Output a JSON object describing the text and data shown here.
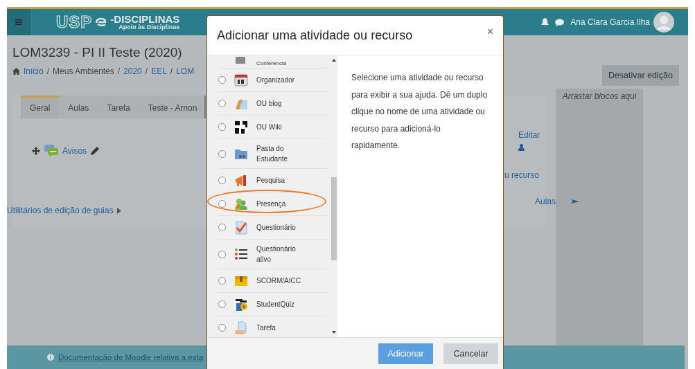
{
  "navbar": {
    "logo": "USP",
    "brand": "-DISCIPLINAS",
    "brand_sub": "Apoio às Disciplinas",
    "user": "Ana Clara Garcia Ilha"
  },
  "page": {
    "title": "LOM3239 - PI II Teste (2020)",
    "breadcrumb_separator": "/",
    "breadcrumb": [
      {
        "label": "Início",
        "link": true
      },
      {
        "label": "Meus Ambientes",
        "link": false
      },
      {
        "label": "2020",
        "link": true
      },
      {
        "label": "EEL",
        "link": true
      },
      {
        "label": "LOM",
        "link": true
      }
    ],
    "edit_button": "Desativar edição",
    "tabs": [
      {
        "label": "Geral",
        "selected": true
      },
      {
        "label": "Aulas",
        "selected": false
      },
      {
        "label": "Tarefa",
        "selected": false
      },
      {
        "label": "Teste - Arnon",
        "selected": false
      }
    ],
    "activity": "Avisos",
    "tab_utilities": "Utilitários de edição de guias",
    "right_links": [
      "Editar",
      "u recurso",
      "Aulas"
    ],
    "blocks_hint": "Arrastar blocos aqui",
    "footer": "Documentação de Moodle relativa a esta"
  },
  "dialog": {
    "title": "Adicionar uma atividade ou recurso",
    "close": "×",
    "items": [
      {
        "label": "Conferência",
        "highlighted": false
      },
      {
        "label": "Organizador",
        "selected": false,
        "highlighted": false
      },
      {
        "label": "OU blog",
        "selected": false,
        "highlighted": false
      },
      {
        "label": "OU Wiki",
        "selected": false,
        "highlighted": false
      },
      {
        "label": "Pasta do Estudante",
        "selected": false,
        "highlighted": false
      },
      {
        "label": "Pesquisa",
        "selected": false,
        "highlighted": false
      },
      {
        "label": "Presença",
        "selected": false,
        "highlighted": true
      },
      {
        "label": "Questionário",
        "selected": false,
        "highlighted": false
      },
      {
        "label": "Questionário ativo",
        "selected": false,
        "highlighted": false
      },
      {
        "label": "SCORM/AICC",
        "selected": false,
        "highlighted": false
      },
      {
        "label": "StudentQuiz",
        "selected": false,
        "highlighted": false
      },
      {
        "label": "Tarefa",
        "selected": false,
        "highlighted": false
      }
    ],
    "help": "Selecione uma atividade ou recurso para exibir a sua ajuda. Dê um duplo clique no nome de uma atividade ou recurso para adicioná-lo rapidamente.",
    "buttons": [
      {
        "label": "Adicionar",
        "kind": "primary"
      },
      {
        "label": "Cancelar",
        "kind": "secondary"
      }
    ]
  }
}
